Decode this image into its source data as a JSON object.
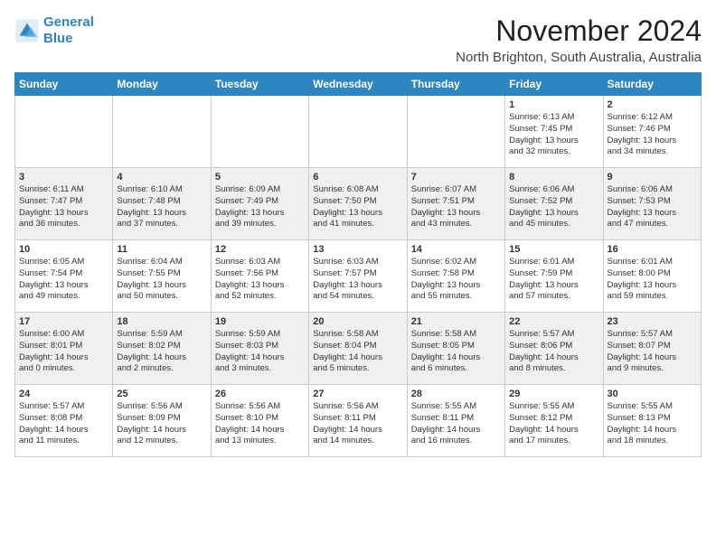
{
  "logo": {
    "line1": "General",
    "line2": "Blue"
  },
  "title": "November 2024",
  "location": "North Brighton, South Australia, Australia",
  "days_header": [
    "Sunday",
    "Monday",
    "Tuesday",
    "Wednesday",
    "Thursday",
    "Friday",
    "Saturday"
  ],
  "weeks": [
    [
      {
        "day": "",
        "info": ""
      },
      {
        "day": "",
        "info": ""
      },
      {
        "day": "",
        "info": ""
      },
      {
        "day": "",
        "info": ""
      },
      {
        "day": "",
        "info": ""
      },
      {
        "day": "1",
        "info": "Sunrise: 6:13 AM\nSunset: 7:45 PM\nDaylight: 13 hours\nand 32 minutes."
      },
      {
        "day": "2",
        "info": "Sunrise: 6:12 AM\nSunset: 7:46 PM\nDaylight: 13 hours\nand 34 minutes."
      }
    ],
    [
      {
        "day": "3",
        "info": "Sunrise: 6:11 AM\nSunset: 7:47 PM\nDaylight: 13 hours\nand 36 minutes."
      },
      {
        "day": "4",
        "info": "Sunrise: 6:10 AM\nSunset: 7:48 PM\nDaylight: 13 hours\nand 37 minutes."
      },
      {
        "day": "5",
        "info": "Sunrise: 6:09 AM\nSunset: 7:49 PM\nDaylight: 13 hours\nand 39 minutes."
      },
      {
        "day": "6",
        "info": "Sunrise: 6:08 AM\nSunset: 7:50 PM\nDaylight: 13 hours\nand 41 minutes."
      },
      {
        "day": "7",
        "info": "Sunrise: 6:07 AM\nSunset: 7:51 PM\nDaylight: 13 hours\nand 43 minutes."
      },
      {
        "day": "8",
        "info": "Sunrise: 6:06 AM\nSunset: 7:52 PM\nDaylight: 13 hours\nand 45 minutes."
      },
      {
        "day": "9",
        "info": "Sunrise: 6:06 AM\nSunset: 7:53 PM\nDaylight: 13 hours\nand 47 minutes."
      }
    ],
    [
      {
        "day": "10",
        "info": "Sunrise: 6:05 AM\nSunset: 7:54 PM\nDaylight: 13 hours\nand 49 minutes."
      },
      {
        "day": "11",
        "info": "Sunrise: 6:04 AM\nSunset: 7:55 PM\nDaylight: 13 hours\nand 50 minutes."
      },
      {
        "day": "12",
        "info": "Sunrise: 6:03 AM\nSunset: 7:56 PM\nDaylight: 13 hours\nand 52 minutes."
      },
      {
        "day": "13",
        "info": "Sunrise: 6:03 AM\nSunset: 7:57 PM\nDaylight: 13 hours\nand 54 minutes."
      },
      {
        "day": "14",
        "info": "Sunrise: 6:02 AM\nSunset: 7:58 PM\nDaylight: 13 hours\nand 55 minutes."
      },
      {
        "day": "15",
        "info": "Sunrise: 6:01 AM\nSunset: 7:59 PM\nDaylight: 13 hours\nand 57 minutes."
      },
      {
        "day": "16",
        "info": "Sunrise: 6:01 AM\nSunset: 8:00 PM\nDaylight: 13 hours\nand 59 minutes."
      }
    ],
    [
      {
        "day": "17",
        "info": "Sunrise: 6:00 AM\nSunset: 8:01 PM\nDaylight: 14 hours\nand 0 minutes."
      },
      {
        "day": "18",
        "info": "Sunrise: 5:59 AM\nSunset: 8:02 PM\nDaylight: 14 hours\nand 2 minutes."
      },
      {
        "day": "19",
        "info": "Sunrise: 5:59 AM\nSunset: 8:03 PM\nDaylight: 14 hours\nand 3 minutes."
      },
      {
        "day": "20",
        "info": "Sunrise: 5:58 AM\nSunset: 8:04 PM\nDaylight: 14 hours\nand 5 minutes."
      },
      {
        "day": "21",
        "info": "Sunrise: 5:58 AM\nSunset: 8:05 PM\nDaylight: 14 hours\nand 6 minutes."
      },
      {
        "day": "22",
        "info": "Sunrise: 5:57 AM\nSunset: 8:06 PM\nDaylight: 14 hours\nand 8 minutes."
      },
      {
        "day": "23",
        "info": "Sunrise: 5:57 AM\nSunset: 8:07 PM\nDaylight: 14 hours\nand 9 minutes."
      }
    ],
    [
      {
        "day": "24",
        "info": "Sunrise: 5:57 AM\nSunset: 8:08 PM\nDaylight: 14 hours\nand 11 minutes."
      },
      {
        "day": "25",
        "info": "Sunrise: 5:56 AM\nSunset: 8:09 PM\nDaylight: 14 hours\nand 12 minutes."
      },
      {
        "day": "26",
        "info": "Sunrise: 5:56 AM\nSunset: 8:10 PM\nDaylight: 14 hours\nand 13 minutes."
      },
      {
        "day": "27",
        "info": "Sunrise: 5:56 AM\nSunset: 8:11 PM\nDaylight: 14 hours\nand 14 minutes."
      },
      {
        "day": "28",
        "info": "Sunrise: 5:55 AM\nSunset: 8:11 PM\nDaylight: 14 hours\nand 16 minutes."
      },
      {
        "day": "29",
        "info": "Sunrise: 5:55 AM\nSunset: 8:12 PM\nDaylight: 14 hours\nand 17 minutes."
      },
      {
        "day": "30",
        "info": "Sunrise: 5:55 AM\nSunset: 8:13 PM\nDaylight: 14 hours\nand 18 minutes."
      }
    ]
  ]
}
